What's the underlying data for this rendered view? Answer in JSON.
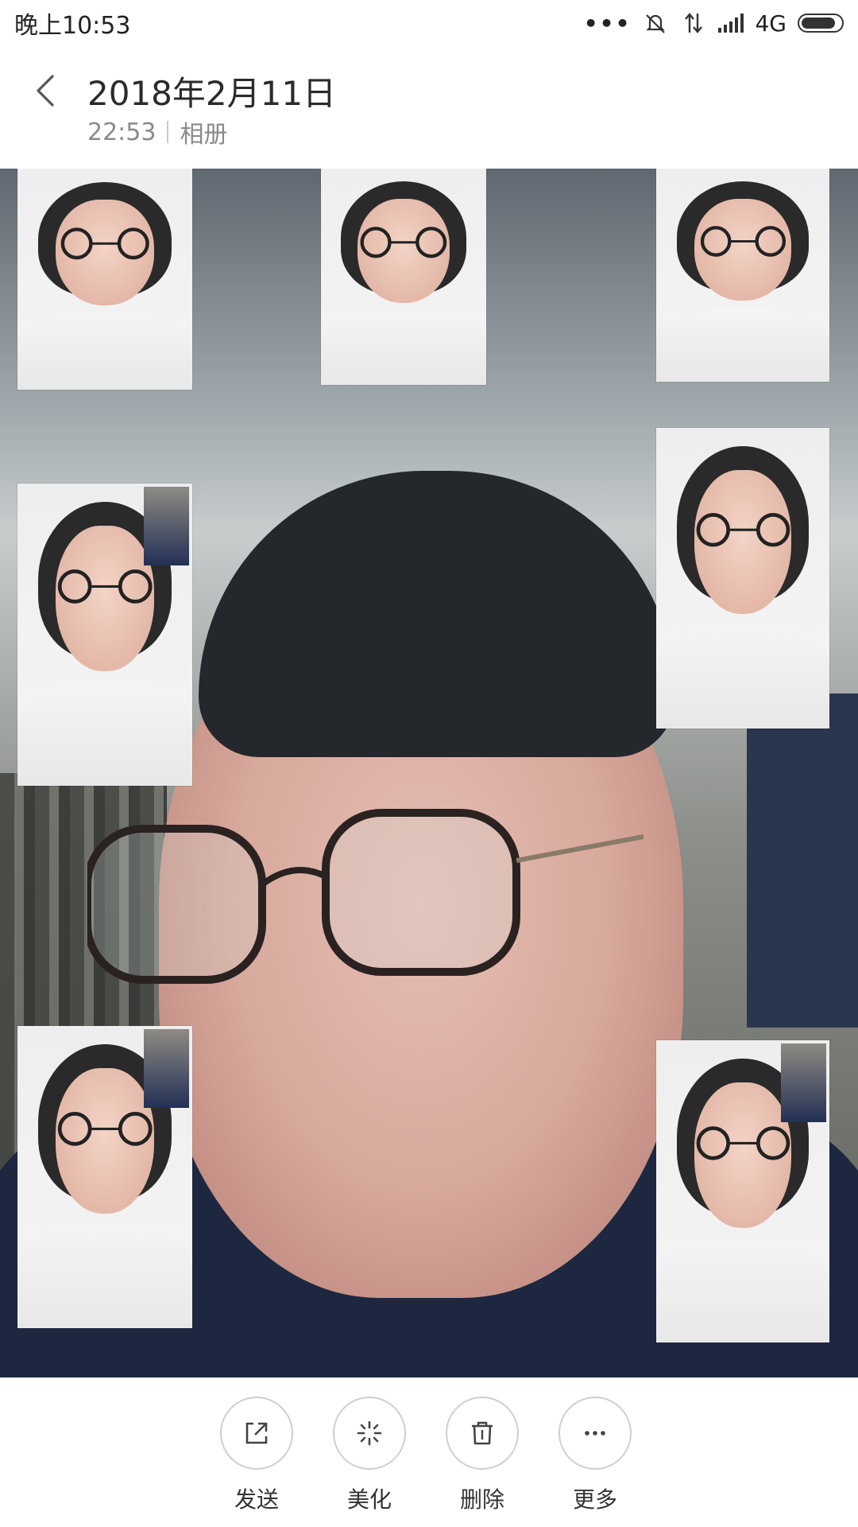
{
  "status_bar": {
    "time": "晚上10:53",
    "network": "4G",
    "icons": [
      "more-dots-icon",
      "mute-icon",
      "data-transfer-icon",
      "signal-icon",
      "battery-icon"
    ]
  },
  "header": {
    "title": "2018年2月11日",
    "time": "22:53",
    "album": "相册"
  },
  "toolbar": {
    "items": [
      {
        "label": "发送",
        "icon": "share-icon"
      },
      {
        "label": "美化",
        "icon": "beautify-icon"
      },
      {
        "label": "删除",
        "icon": "trash-icon"
      },
      {
        "label": "更多",
        "icon": "more-icon"
      }
    ]
  },
  "colors": {
    "text_primary": "#2b2b2b",
    "text_secondary": "#8a8a8a",
    "circle_border": "#cfcfcf"
  }
}
